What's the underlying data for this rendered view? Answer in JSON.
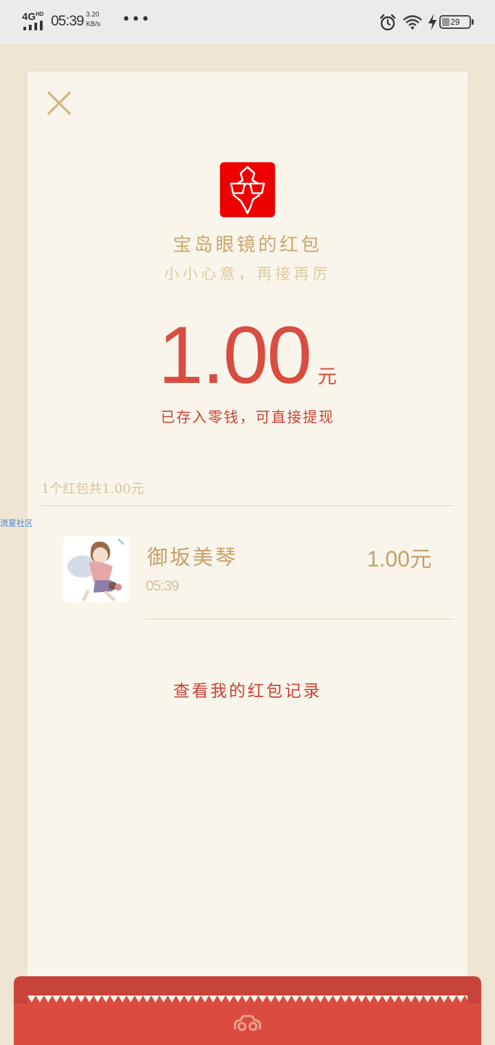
{
  "status_bar": {
    "network": "4G",
    "network_hd": "HD",
    "time": "05:39",
    "speed_value": "3.20",
    "speed_unit": "KB/s",
    "more": "•••",
    "battery_level": "29",
    "battery_fraction": 0.29
  },
  "envelope": {
    "title": "宝岛眼镜的红包",
    "subtitle": "小小心意，再接再厉",
    "amount": "1.00",
    "amount_unit": "元",
    "deposit_note": "已存入零钱，可直接提现",
    "summary": "1个红包共1.00元"
  },
  "watermark": "流星社区",
  "receivers": [
    {
      "name": "御坂美琴",
      "time": "05:39",
      "amount": "1.00元"
    }
  ],
  "records_link": "查看我的红包记录",
  "colors": {
    "accent_red": "#d94c41",
    "gold": "#c2a06d",
    "card_bg": "#faf5ea",
    "logo_red": "#ee0000"
  },
  "icons": {
    "close": "close-icon",
    "alarm": "alarm-icon",
    "wifi": "wifi-icon",
    "charge": "charging-icon",
    "cloud": "cloud-emblem-icon"
  }
}
